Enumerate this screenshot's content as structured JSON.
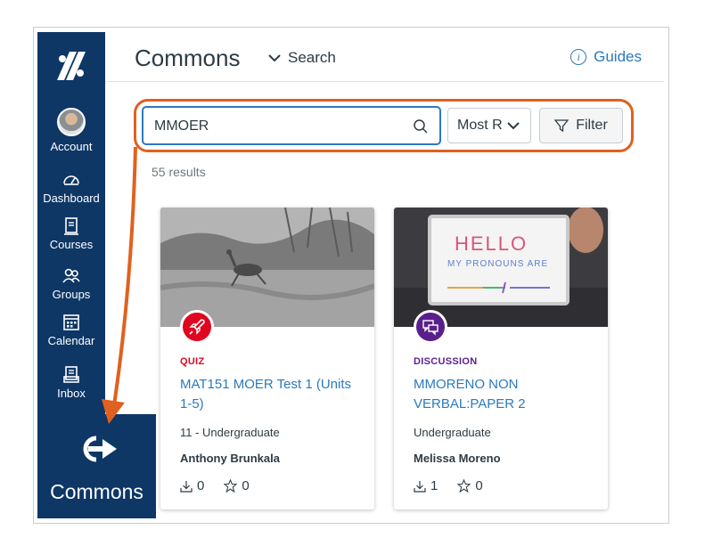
{
  "sidebar": {
    "items": [
      {
        "label": "Account",
        "icon": "avatar"
      },
      {
        "label": "Dashboard",
        "icon": "dashboard-icon"
      },
      {
        "label": "Courses",
        "icon": "courses-icon"
      },
      {
        "label": "Groups",
        "icon": "groups-icon"
      },
      {
        "label": "Calendar",
        "icon": "calendar-icon"
      },
      {
        "label": "Inbox",
        "icon": "inbox-icon"
      }
    ],
    "commons_label": "Commons"
  },
  "header": {
    "title": "Commons",
    "search_label": "Search",
    "guides_label": "Guides"
  },
  "search": {
    "value": "MMOER",
    "sort_value": "Most R",
    "filter_label": "Filter"
  },
  "results_text": "55 results",
  "cards": [
    {
      "type": "QUIZ",
      "type_color": "#e0061f",
      "title": "MAT151 MOER Test 1 (Units 1-5)",
      "grade": "11 - Undergraduate",
      "author": "Anthony Brunkala",
      "downloads": "0",
      "favorites": "0"
    },
    {
      "type": "DISCUSSION",
      "type_color": "#5a1f8c",
      "title": "MMORENO NON VERBAL:PAPER 2",
      "grade": "Undergraduate",
      "author": "Melissa Moreno",
      "downloads": "1",
      "favorites": "0"
    }
  ],
  "colors": {
    "sidebar": "#0e3766",
    "link": "#2b7abc",
    "highlight": "#e0611f"
  }
}
